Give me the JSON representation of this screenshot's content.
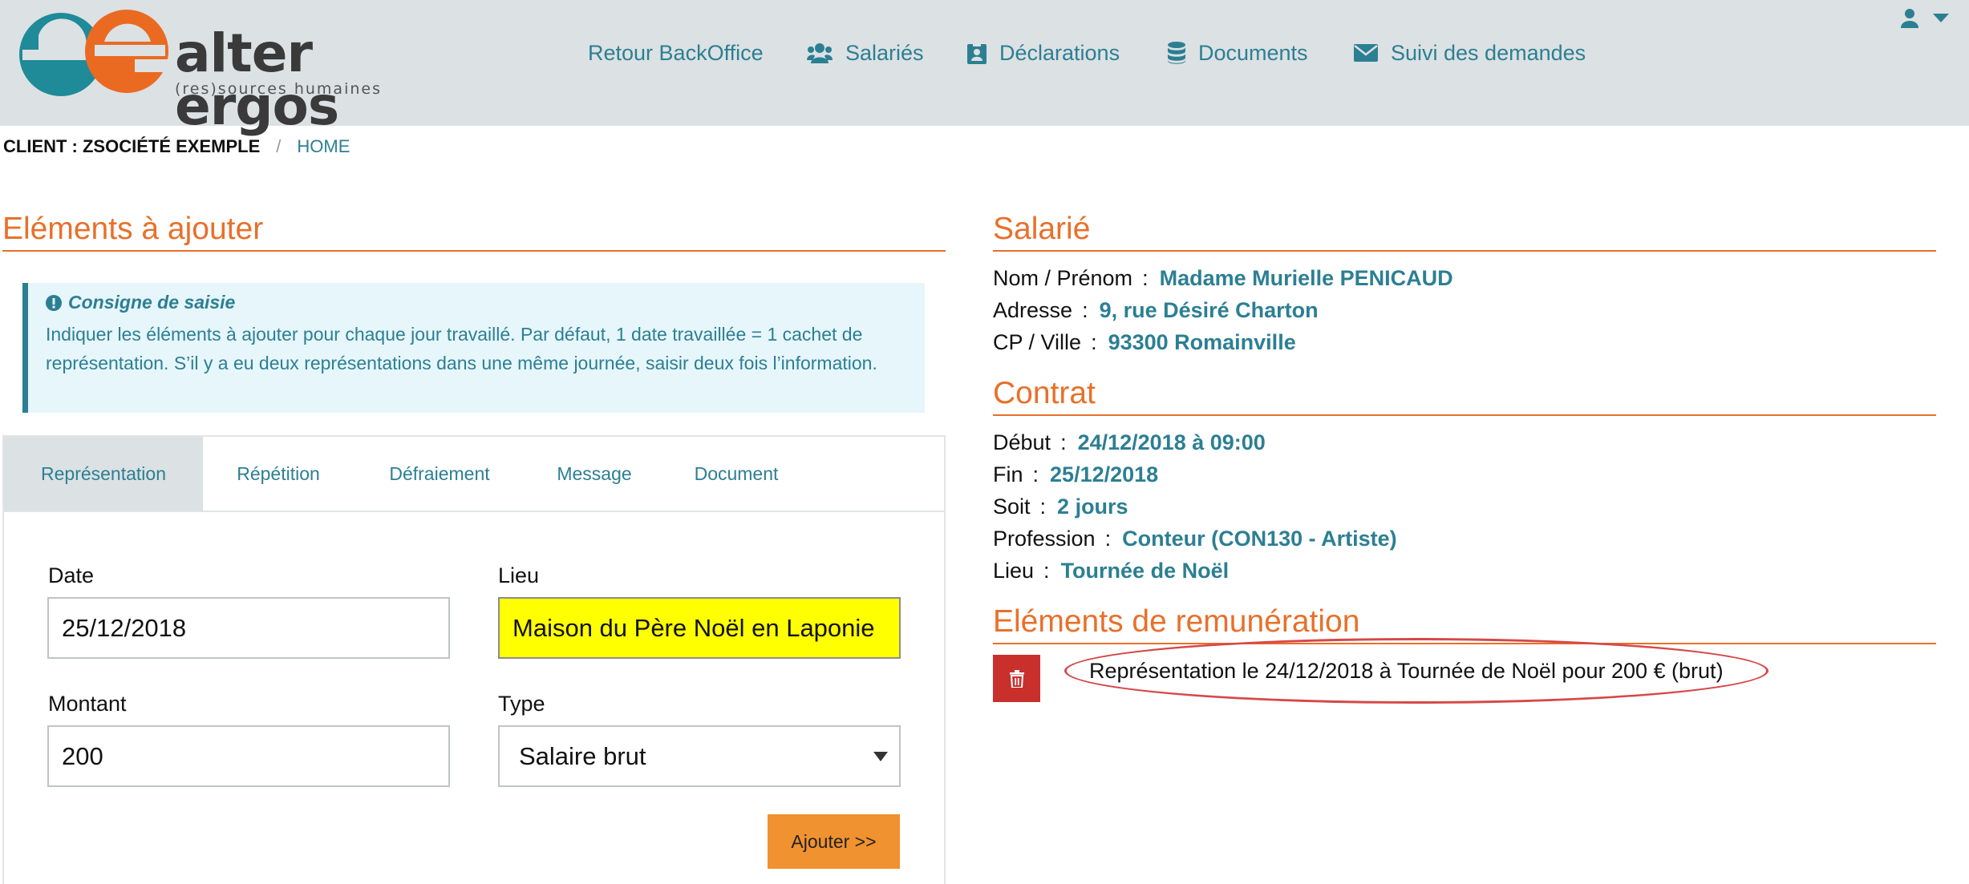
{
  "brand": {
    "name": "alter ergos",
    "tagline": "(res)sources humaines",
    "colors": {
      "teal": "#2c7f93",
      "orange": "#e8702a"
    }
  },
  "nav": {
    "items": [
      {
        "label": "Retour BackOffice",
        "icon": ""
      },
      {
        "label": "Salariés",
        "icon": "users-icon"
      },
      {
        "label": "Déclarations",
        "icon": "clipboard-icon"
      },
      {
        "label": "Documents",
        "icon": "database-icon"
      },
      {
        "label": "Suivi des demandes",
        "icon": "envelope-icon"
      }
    ],
    "user_icon": "user-icon",
    "caret_icon": "caret-down-icon"
  },
  "breadcrumb": {
    "client": "CLIENT : ZSOCIÉTÉ EXEMPLE",
    "separator": "/",
    "home": "HOME"
  },
  "left": {
    "title": "Eléments à ajouter",
    "consigne": {
      "title": "Consigne de saisie",
      "text": "Indiquer les éléments à ajouter pour chaque jour travaillé. Par défaut, 1 date travaillée = 1 cachet de représentation. S’il y a eu deux représentations dans une même journée, saisir deux fois l’information."
    },
    "tabs": [
      {
        "label": "Représentation",
        "active": true
      },
      {
        "label": "Répétition",
        "active": false
      },
      {
        "label": "Défraiement",
        "active": false
      },
      {
        "label": "Message",
        "active": false
      },
      {
        "label": "Document",
        "active": false
      }
    ],
    "form": {
      "date_label": "Date",
      "date_value": "25/12/2018",
      "lieu_label": "Lieu",
      "lieu_value": "Maison du Père Noël en Laponie",
      "montant_label": "Montant",
      "montant_value": "200",
      "type_label": "Type",
      "type_value": "Salaire brut",
      "submit_label": "Ajouter >>"
    }
  },
  "salarie": {
    "title": "Salarié",
    "nom_label": "Nom / Prénom",
    "nom_value": "Madame Murielle PENICAUD",
    "adresse_label": "Adresse",
    "adresse_value": "9, rue Désiré Charton",
    "cp_label": "CP / Ville",
    "cp_value": "93300 Romainville"
  },
  "contrat": {
    "title": "Contrat",
    "debut_label": "Début",
    "debut_value": "24/12/2018 à 09:00",
    "fin_label": "Fin",
    "fin_value": "25/12/2018",
    "soit_label": "Soit",
    "soit_value": "2 jours",
    "profession_label": "Profession",
    "profession_value": "Conteur (CON130 - Artiste)",
    "lieu_label": "Lieu",
    "lieu_value": "Tournée de Noël"
  },
  "remuneration": {
    "title": "Eléments de remunération",
    "items": [
      {
        "text": "Représentation le 24/12/2018 à Tournée de Noël pour 200 € (brut)"
      }
    ],
    "delete_icon": "trash-icon",
    "annotation_color": "#d64848"
  },
  "label_separator": ":"
}
